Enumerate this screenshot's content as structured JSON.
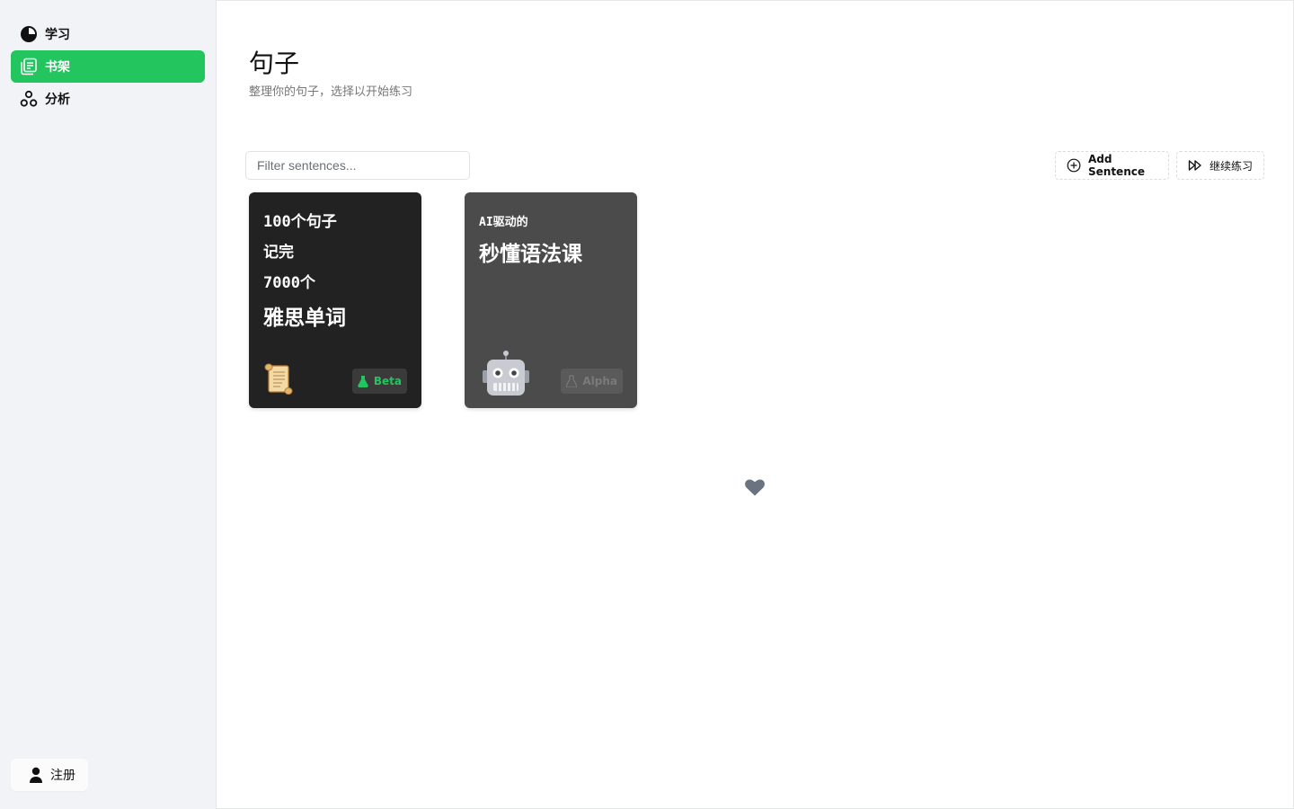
{
  "sidebar": {
    "items": [
      {
        "label": "学习",
        "icon": "progress-circle-icon",
        "active": false
      },
      {
        "label": "书架",
        "icon": "bookshelf-icon",
        "active": true
      },
      {
        "label": "分析",
        "icon": "analysis-icon",
        "active": false
      }
    ],
    "signup_label": "注册"
  },
  "page": {
    "title": "句子",
    "subtitle": "整理你的句子，选择以开始练习"
  },
  "toolbar": {
    "filter_placeholder": "Filter sentences...",
    "add_label": "Add Sentence",
    "continue_label": "继续练习"
  },
  "cards": [
    {
      "lines": [
        "100个句子",
        "记完",
        "7000个"
      ],
      "headline": "雅思单词",
      "emoji_icon": "scroll-icon",
      "badge": "Beta"
    },
    {
      "lines": [
        "AI驱动的"
      ],
      "headline": "秒懂语法课",
      "emoji_icon": "robot-icon",
      "badge": "Alpha"
    }
  ],
  "colors": {
    "accent": "#22c55e",
    "card1_bg": "#222222",
    "card2_bg": "#4b4b4b",
    "sidebar_bg": "#f1f3f6"
  }
}
